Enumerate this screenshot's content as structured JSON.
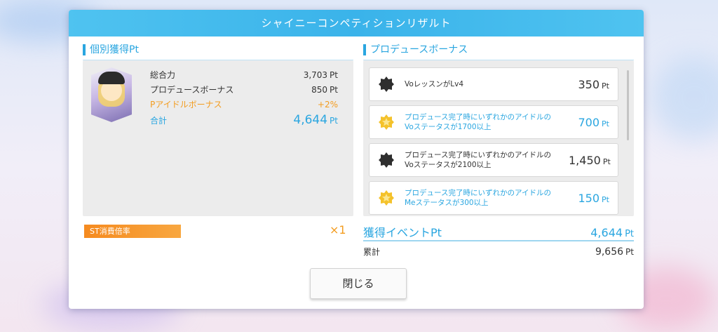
{
  "dialog": {
    "title": "シャイニーコンペティションリザルト"
  },
  "individual": {
    "heading": "個別獲得Pt",
    "rows": [
      {
        "label": "総合力",
        "value": "3,703",
        "unit": "Pt"
      },
      {
        "label": "プロデュースボーナス",
        "value": "850",
        "unit": "Pt"
      },
      {
        "label": "Pアイドルボーナス",
        "value": "+2%",
        "unit": ""
      },
      {
        "label": "合計",
        "value": "4,644",
        "unit": "Pt"
      }
    ]
  },
  "produce_bonus": {
    "heading": "プロデュースボーナス",
    "items": [
      {
        "text": "VoレッスンがLv4",
        "value": "350",
        "unit": "Pt",
        "icon": "star-badge-dark-icon",
        "achieved": false
      },
      {
        "text": "プロデュース完了時にいずれかのアイドルの\nVoステータスが1700以上",
        "value": "700",
        "unit": "Pt",
        "icon": "star-badge-gold-icon",
        "achieved": true
      },
      {
        "text": "プロデュース完了時にいずれかのアイドルの\nVoステータスが2100以上",
        "value": "1,450",
        "unit": "Pt",
        "icon": "star-badge-dark-icon",
        "achieved": false
      },
      {
        "text": "プロデュース完了時にいずれかのアイドルの\nMeステータスが300以上",
        "value": "150",
        "unit": "Pt",
        "icon": "star-badge-gold-icon",
        "achieved": true
      }
    ]
  },
  "st": {
    "label": "ST消費倍率",
    "multiplier": "×1"
  },
  "event": {
    "label": "獲得イベントPt",
    "value": "4,644",
    "unit": "Pt"
  },
  "total": {
    "label": "累計",
    "value": "9,656",
    "unit": "Pt"
  },
  "close_label": "閉じる",
  "colors": {
    "accent_blue": "#2aa6e0",
    "accent_orange": "#f39c1f",
    "title_bar": "#3ab3ea"
  }
}
